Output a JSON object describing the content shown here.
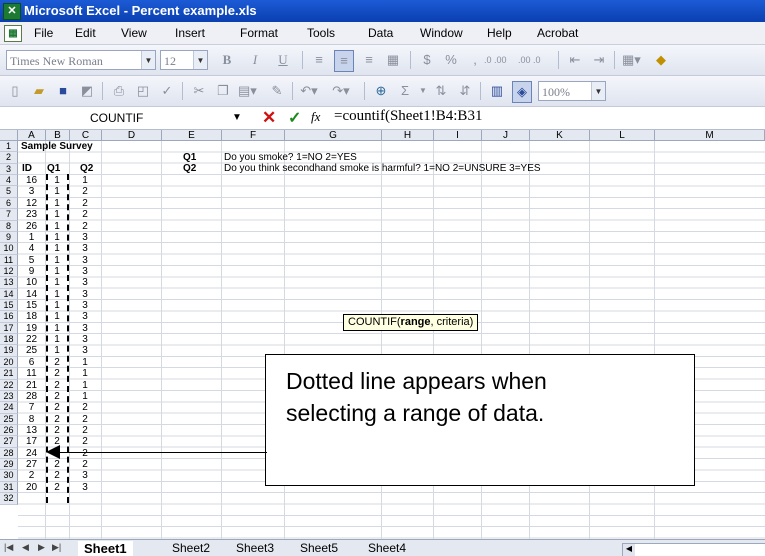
{
  "window": {
    "title": "Microsoft Excel - Percent example.xls"
  },
  "menu": [
    "File",
    "Edit",
    "View",
    "Insert",
    "Format",
    "Tools",
    "Data",
    "Window",
    "Help",
    "Acrobat"
  ],
  "toolbar": {
    "font_name": "Times New Roman",
    "font_size": "12",
    "zoom": "100%",
    "bold": "B",
    "italic": "I",
    "underline": "U",
    "currency": "$",
    "percent": "%",
    "comma": ",",
    "inc_decimal": ".0 .00",
    "dec_decimal": ".00 .0",
    "sum": "Σ"
  },
  "formula_bar": {
    "name_box": "COUNTIF",
    "cancel": "✕",
    "enter": "✓",
    "fx": "fx",
    "formula": "=countif(Sheet1!B4:B31"
  },
  "columns": [
    "A",
    "B",
    "C",
    "D",
    "E",
    "F",
    "G",
    "H",
    "I",
    "J",
    "K",
    "L",
    "M"
  ],
  "rows": [
    "1",
    "2",
    "3",
    "4",
    "5",
    "6",
    "7",
    "8",
    "9",
    "10",
    "11",
    "12",
    "13",
    "14",
    "15",
    "16",
    "17",
    "18",
    "19",
    "20",
    "21",
    "22",
    "23",
    "24",
    "25",
    "26",
    "27",
    "28",
    "29",
    "30",
    "31",
    "32"
  ],
  "sheet": {
    "title": "Sample Survey",
    "headers": {
      "id": "ID",
      "q1": "Q1",
      "q2": "Q2"
    },
    "q1_label": "Q1",
    "q1_text": "Do you smoke? 1=NO  2=YES",
    "q2_label": "Q2",
    "q2_text": "Do you think secondhand smoke is harmful?  1=NO  2=UNSURE  3=YES",
    "data": [
      [
        "16",
        "1",
        "1"
      ],
      [
        "3",
        "1",
        "2"
      ],
      [
        "12",
        "1",
        "2"
      ],
      [
        "23",
        "1",
        "2"
      ],
      [
        "26",
        "1",
        "2"
      ],
      [
        "1",
        "1",
        "3"
      ],
      [
        "4",
        "1",
        "3"
      ],
      [
        "5",
        "1",
        "3"
      ],
      [
        "9",
        "1",
        "3"
      ],
      [
        "10",
        "1",
        "3"
      ],
      [
        "14",
        "1",
        "3"
      ],
      [
        "15",
        "1",
        "3"
      ],
      [
        "18",
        "1",
        "3"
      ],
      [
        "19",
        "1",
        "3"
      ],
      [
        "22",
        "1",
        "3"
      ],
      [
        "25",
        "1",
        "3"
      ],
      [
        "6",
        "2",
        "1"
      ],
      [
        "11",
        "2",
        "1"
      ],
      [
        "21",
        "2",
        "1"
      ],
      [
        "28",
        "2",
        "1"
      ],
      [
        "7",
        "2",
        "2"
      ],
      [
        "8",
        "2",
        "2"
      ],
      [
        "13",
        "2",
        "2"
      ],
      [
        "17",
        "2",
        "2"
      ],
      [
        "24",
        "2",
        "2"
      ],
      [
        "27",
        "2",
        "2"
      ],
      [
        "2",
        "2",
        "3"
      ],
      [
        "20",
        "2",
        "3"
      ]
    ]
  },
  "tooltip": {
    "prefix": "COUNTIF(",
    "arg1": "range",
    "rest": ", criteria)"
  },
  "callout": {
    "line1": "Dotted line appears when",
    "line2": "selecting a range of data."
  },
  "tabs": [
    "Sheet1",
    "Sheet2",
    "Sheet3",
    "Sheet5",
    "Sheet4"
  ]
}
